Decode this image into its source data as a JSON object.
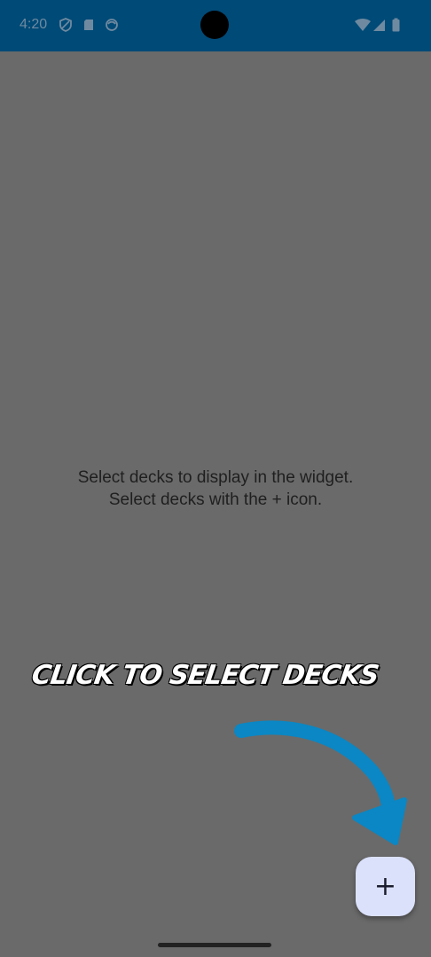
{
  "status_bar": {
    "time": "4:20",
    "left_icons": [
      "shield-icon",
      "sd-card-icon",
      "face-icon"
    ],
    "right_icons": [
      "wifi-icon",
      "signal-icon",
      "battery-icon"
    ],
    "background": "#004a77"
  },
  "main": {
    "empty_line1": "Select decks to display in the widget.",
    "empty_line2": "Select decks with the + icon."
  },
  "annotation": {
    "label": "CLICK TO SELECT DECKS",
    "arrow_color": "#0a87c4"
  },
  "fab": {
    "label": "+",
    "background": "#dbe1fb"
  }
}
